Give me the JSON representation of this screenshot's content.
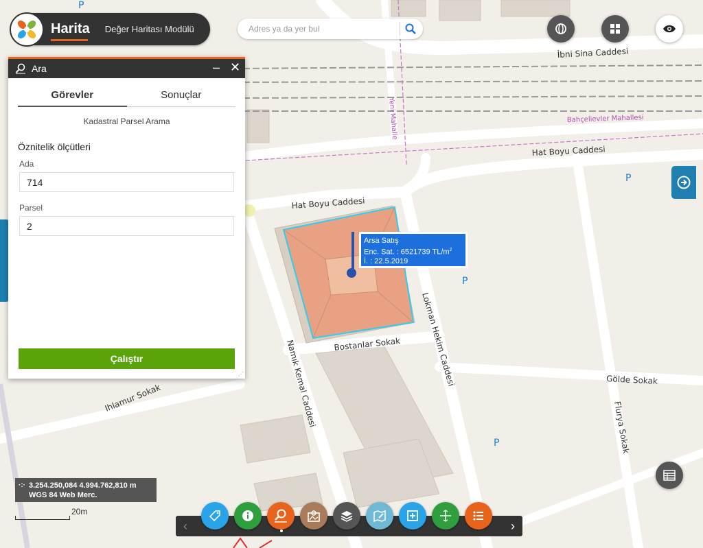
{
  "brand": {
    "title": "Harita",
    "subtitle": "Değer Haritası Modülü"
  },
  "search": {
    "placeholder": "Adres ya da yer bul",
    "value": ""
  },
  "panel": {
    "title": "Ara",
    "tabs": [
      {
        "label": "Görevler",
        "active": true
      },
      {
        "label": "Sonuçlar",
        "active": false
      }
    ],
    "subtitle": "Kadastral Parsel Arama",
    "section_title": "Öznitelik ölçütleri",
    "fields": [
      {
        "label": "Ada",
        "value": "714"
      },
      {
        "label": "Parsel",
        "value": "2"
      }
    ],
    "run_label": "Çalıştır",
    "minimize_label": "–",
    "close_label": "✕"
  },
  "popup": {
    "line1": "Arsa Satış",
    "line2_prefix": "Enc. Sat. : 6521739 TL/m",
    "line2_sup": "2",
    "line3": "İ. : 22.5.2019"
  },
  "map": {
    "streets": [
      "İbni Sina Caddesi",
      "Hat Boyu Caddesi",
      "Hat Boyu Caddesi",
      "Bostanlar Sokak",
      "Lokman Hekim Caddesi",
      "Namık Kemal Caddesi",
      "Gölde Sokak",
      "Flurya Sokak",
      "Ihlamur Sokak"
    ],
    "neighborhoods": [
      "Yeni Mahalle",
      "Bahçelievler Mahallesi"
    ],
    "parking_label": "P"
  },
  "coords": {
    "line1": "3.254.250,084 4.994.762,810 m",
    "line2": "WGS 84 Web Merc."
  },
  "scale": {
    "label": "20m"
  },
  "toolbar": {
    "prev": "‹",
    "next": "›",
    "tools": [
      {
        "name": "tag-icon",
        "color": "#2aa4e8"
      },
      {
        "name": "info-icon",
        "color": "#2e9e3e"
      },
      {
        "name": "search-map-icon",
        "color": "#e8641c"
      },
      {
        "name": "map-picture-icon",
        "color": "#a87c5a"
      },
      {
        "name": "layers-icon",
        "color": "#555555"
      },
      {
        "name": "map-edit-icon",
        "color": "#6fb9d6"
      },
      {
        "name": "add-frame-icon",
        "color": "#2aa4e8"
      },
      {
        "name": "measure-icon",
        "color": "#2e9e3e"
      },
      {
        "name": "list-icon",
        "color": "#e8641c"
      }
    ]
  },
  "colors": {
    "accent": "#e8641c",
    "dark": "#333333",
    "run": "#5aa30a",
    "popup": "#1e6fde",
    "parcel": "#e8a183"
  }
}
